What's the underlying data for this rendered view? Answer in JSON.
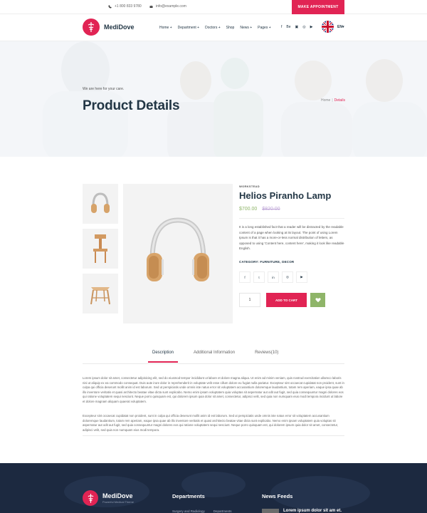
{
  "topbar": {
    "phone": "+1 800 833 9780",
    "email": "info@example.com",
    "appointment_button": "MAKE APPOINTMENT"
  },
  "nav": {
    "logo": "MediDove",
    "menu": [
      "Home +",
      "Department +",
      "Doctors +",
      "Shop",
      "News +",
      "Pages +"
    ],
    "social": [
      "f",
      "Be",
      "▣",
      "◎",
      "▶"
    ],
    "language": "EN▾"
  },
  "hero": {
    "subtitle": "We are here for your care.",
    "title": "Product Details",
    "breadcrumb": [
      "Home",
      "Details"
    ]
  },
  "product": {
    "category_small": "WORKSTEAD",
    "title": "Helios Piranho Lamp",
    "price_current": "$700.00",
    "price_old": "$820.00",
    "description": "It is a long established fact that a reader will be distracted by the readable content of a page when looking at its layout. The point of using Lorem Ipsum is that it has a more-or-less normal distribution of letters, as opposed to using 'Content here, content here', making it look like readable English.",
    "category_label": "CATEGORY: FURNITURE, DECOR",
    "share": [
      "f",
      "t",
      "in",
      "◎",
      "▶"
    ],
    "quantity": "1",
    "add_to_cart": "ADD TO CART",
    "colors": {
      "accent": "#e12454",
      "green": "#8fb569",
      "dark": "#223645"
    }
  },
  "tabs": {
    "items": [
      "Description",
      "Additional Information",
      "Reviews(10)"
    ],
    "active": "Description",
    "paragraph1": "Lorem ipsum dolor sit amet, consectetur adipisicing elit, sed do eiusmod tempor incididunt ut labore et dolore magna aliqua. Ut enim ad minim veniam, quis nostrud exercitation ullamco laboris nisi ut aliquip ex ea commodo consequat. Duis aute irure dolor in reprehenderit in voluptate velit esse cillum dolore eu fugiat nulla pariatur. Excepteur sint occaecat cupidatat non proident, sunt in culpa qui officia deserunt mollit anim id est laborum. Sed ut perspiciatis unde omnis iste natus error sit voluptatem accusantium doloremque laudantium, totam rem aperiam, eaque ipsa quae ab illo inventore veritatis et quasi architecto beatae vitae dicta sunt explicabo. Nemo enim ipsam voluptatem quia voluptas sit aspernatur aut odit aut fugit, sed quia consequuntur magni dolores eos qui ratione voluptatem sequi nesciunt. Neque porro quisquam est, qui dolorem ipsum quia dolor sit amet, consectetur, adipisci velit, sed quia non numquam eius modi tempora incidunt ut labore et dolore magnam aliquam quaerat voluptatem.",
    "paragraph2": "Excepteur sint occaecat cupidatat non proident, sunt in culpa qui officia deserunt mollit anim id est laborum. Sed ut perspiciatis unde omnis iste natus error sit voluptatem accusantium doloremque laudantium, totam rem aperiam, eaque ipsa quae ab illo inventore veritatis et quasi architecto beatae vitae dicta sunt explicabo. Nemo enim ipsam voluptatem quia voluptas sit aspernatur aut odit aut fugit, sed quia consequuntur magni dolores eos qui ratione voluptatem sequi nesciunt. Neque porro quisquam est, qui dolorem ipsum quia dolor sit amet, consectetur, adipisci velit, sed quia non numquam eius modi tempora."
  },
  "footer": {
    "logo": "MediDove",
    "tagline": "Powerful Medical Theme",
    "departments_heading": "Departments",
    "news_heading": "News Feeds",
    "links": [
      "Surgery and Radiology",
      "Departments"
    ],
    "news_title": "Lorem ipsum dolor sit am et."
  }
}
